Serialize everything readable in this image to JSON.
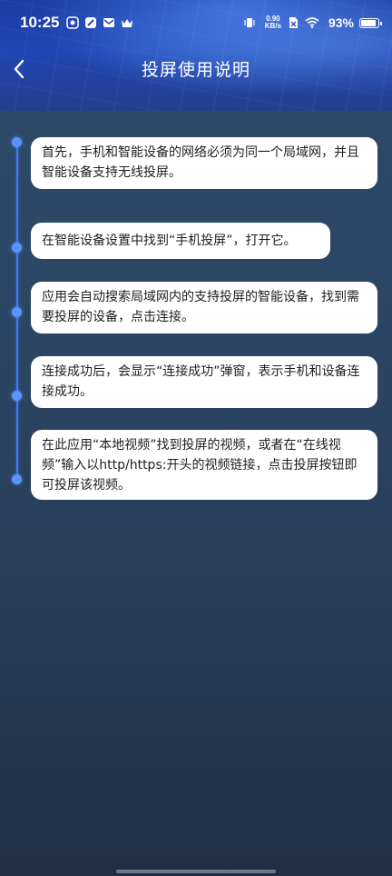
{
  "status_bar": {
    "time": "10:25",
    "net_speed_value": "0.90",
    "net_speed_unit": "KB/s",
    "battery_percent": "93%",
    "battery_level": 0.93,
    "icons": [
      "app-notification-icon",
      "app-notification-icon",
      "mail-icon",
      "crown-icon",
      "vibrate-icon",
      "sim-icon",
      "wifi-icon",
      "battery-icon"
    ]
  },
  "header": {
    "back_icon": "chevron-left-icon",
    "title": "投屏使用说明"
  },
  "steps": [
    {
      "text": "首先，手机和智能设备的网络必须为同一个局域网，并且智能设备支持无线投屏。"
    },
    {
      "text": "在智能设备设置中找到“手机投屏”，打开它。"
    },
    {
      "text": "应用会自动搜索局域网内的支持投屏的智能设备，找到需要投屏的设备，点击连接。"
    },
    {
      "text": "连接成功后，会显示“连接成功”弹窗，表示手机和设备连接成功。"
    },
    {
      "text": "在此应用“本地视频”找到投屏的视频，或者在“在线视频”输入以http/https:开头的视频链接，点击投屏按钮即可投屏该视频。"
    }
  ],
  "colors": {
    "timeline": "#3f7bff",
    "header": "#1f46b4",
    "background": "#2b4563",
    "card": "#ffffff",
    "card_text": "#1e1e1e"
  }
}
